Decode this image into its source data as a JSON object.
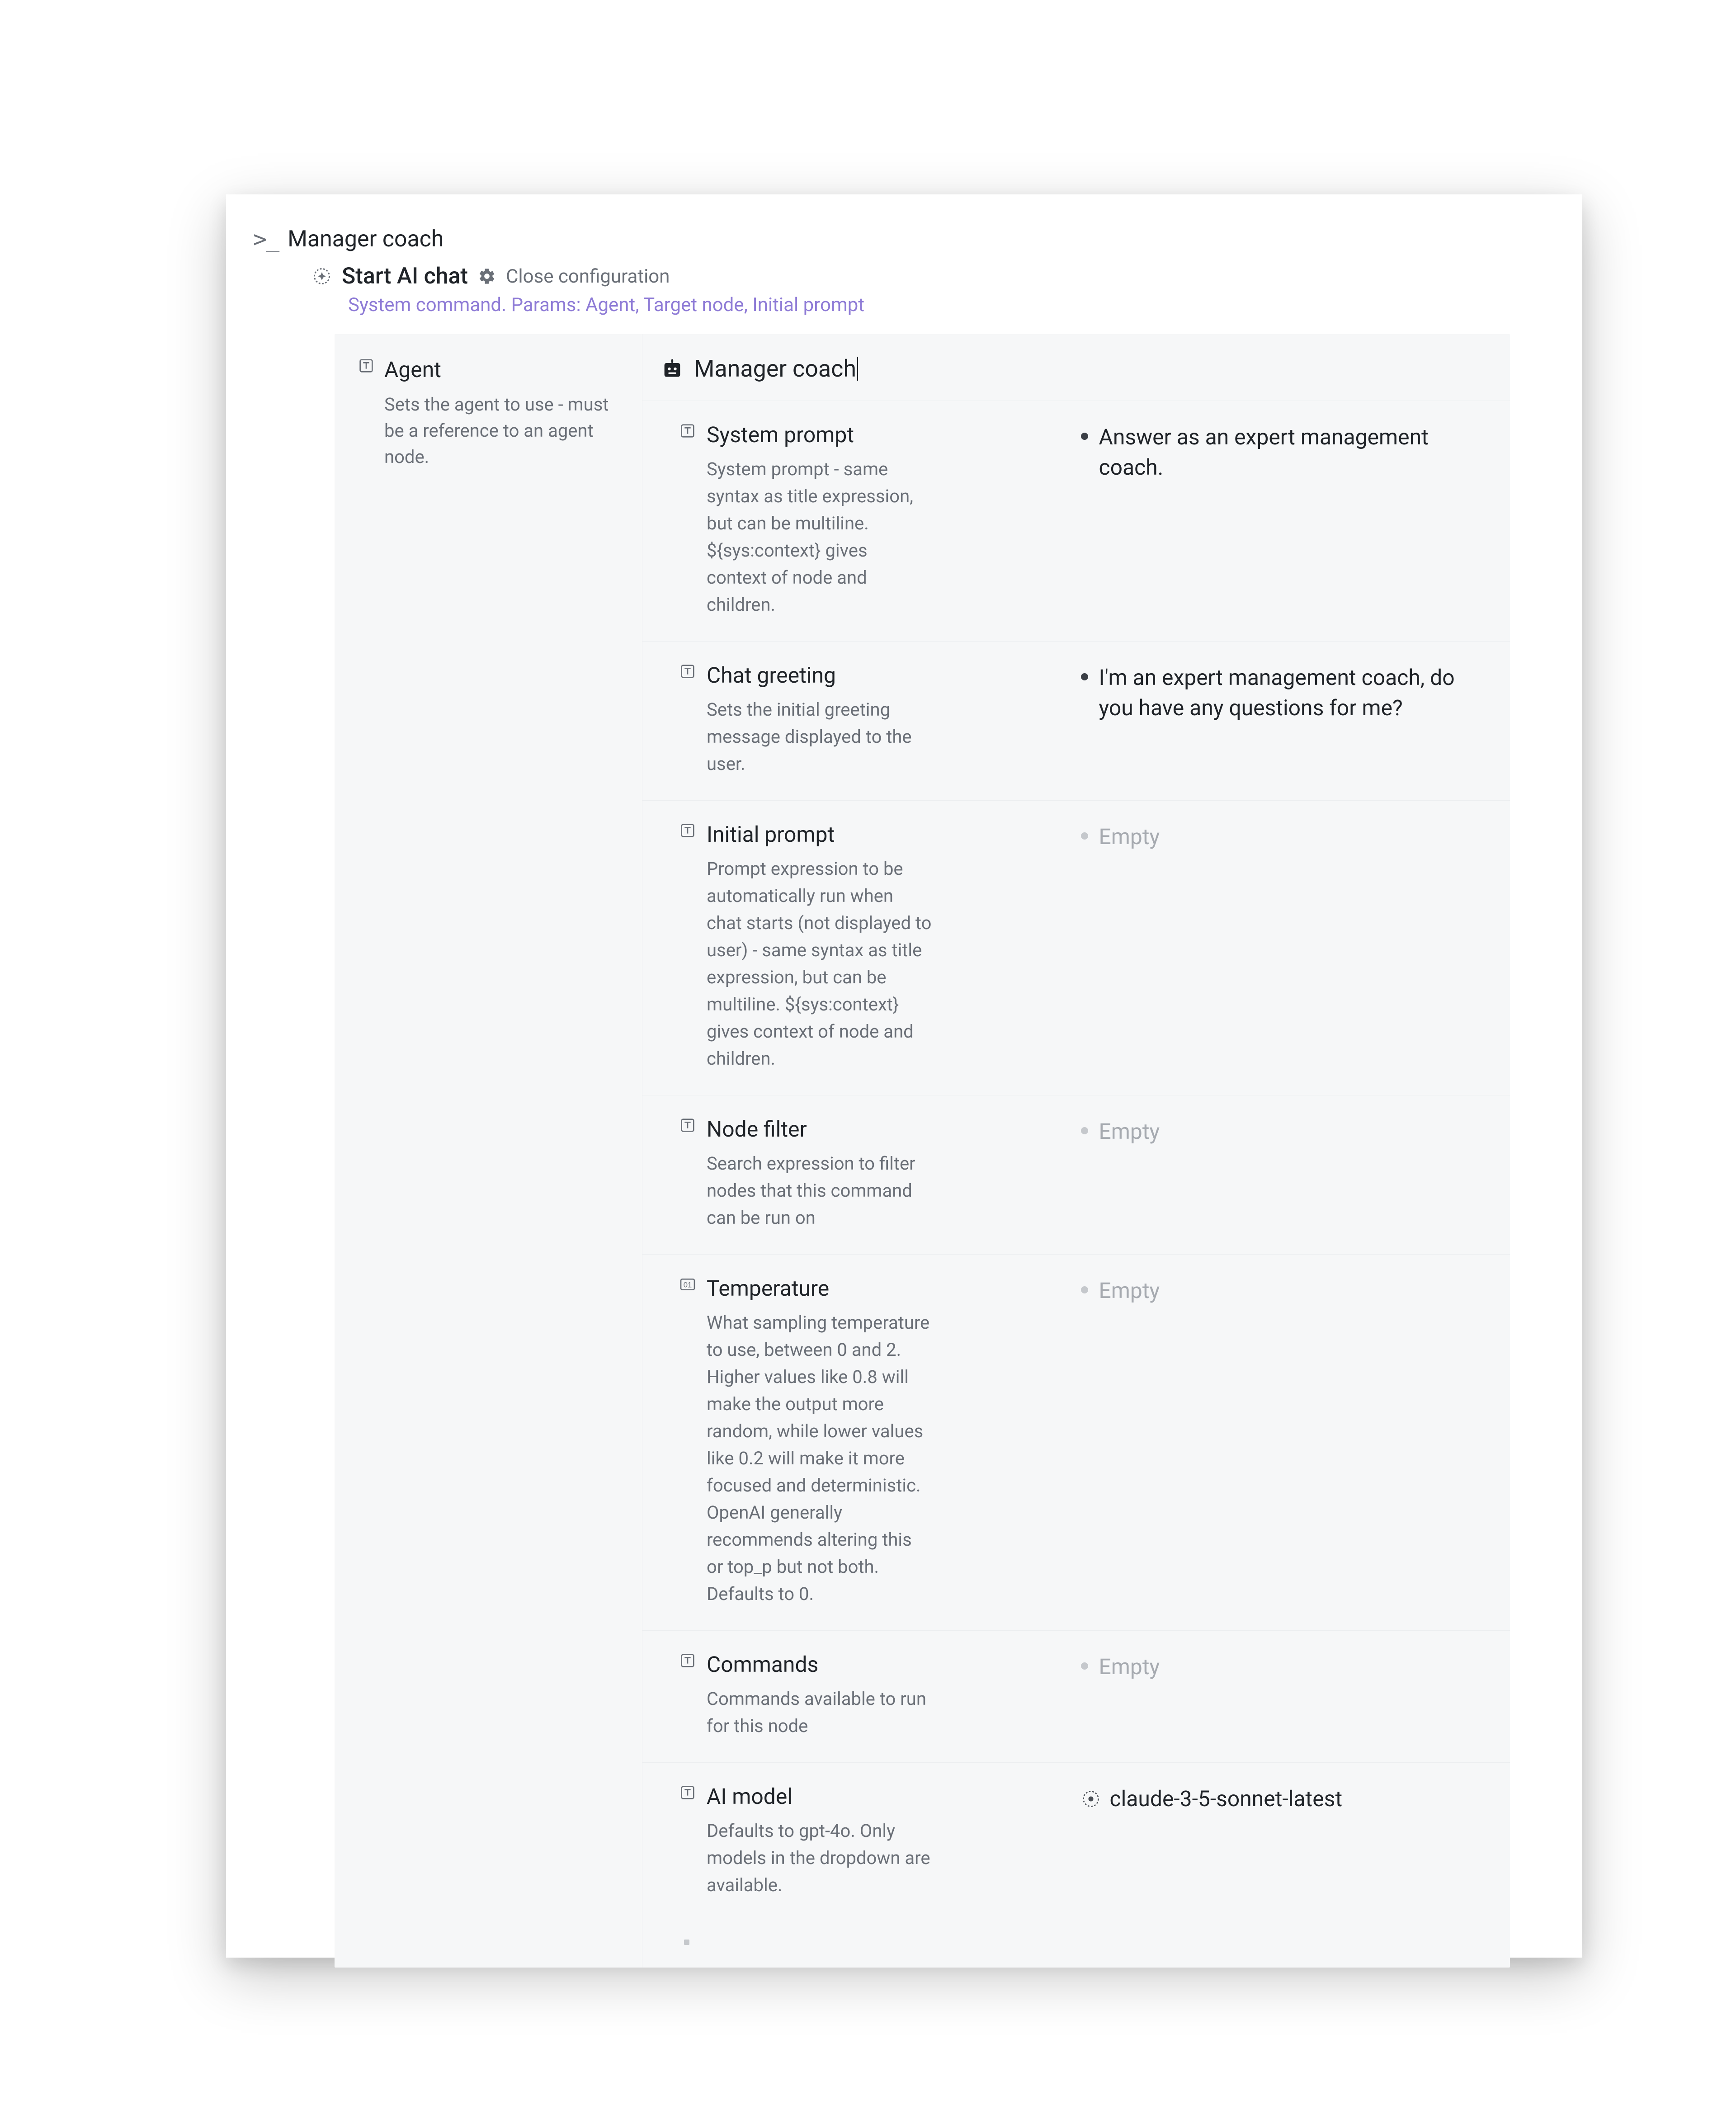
{
  "breadcrumb": {
    "title": "Manager coach"
  },
  "startRow": {
    "label": "Start AI chat",
    "closeLabel": "Close configuration"
  },
  "paramsLine": "System command. Params: Agent, Target node, Initial prompt",
  "agent": {
    "label": "Agent",
    "desc": "Sets the agent to use - must be a reference to an agent node.",
    "value": "Manager coach"
  },
  "props": [
    {
      "key": "system_prompt",
      "icon": "text",
      "title": "System prompt",
      "desc": "System prompt - same syntax as title expression, but can be multiline. ${sys:context} gives context of node and children.",
      "value": "Answer as an expert management coach.",
      "valueKind": "text"
    },
    {
      "key": "chat_greeting",
      "icon": "text",
      "title": "Chat greeting",
      "desc": "Sets the initial greeting message displayed to the user.",
      "value": "I'm an expert management coach, do you have any questions for me?",
      "valueKind": "text"
    },
    {
      "key": "initial_prompt",
      "icon": "text",
      "title": "Initial prompt",
      "desc": "Prompt expression to be automatically run when chat starts (not displayed to user) - same syntax as title expression, but can be multiline. ${sys:context} gives context of node and children.",
      "value": "Empty",
      "valueKind": "empty"
    },
    {
      "key": "node_filter",
      "icon": "text",
      "title": "Node filter",
      "desc": "Search expression to filter nodes that this command can be run on",
      "value": "Empty",
      "valueKind": "empty"
    },
    {
      "key": "temperature",
      "icon": "num",
      "title": "Temperature",
      "desc": "What sampling temperature to use, between 0 and 2. Higher values like 0.8 will make the output more random, while lower values like 0.2 will make it more focused and deterministic. OpenAI generally recommends altering this or top_p but not both. Defaults to 0.",
      "value": "Empty",
      "valueKind": "empty"
    },
    {
      "key": "commands",
      "icon": "text",
      "title": "Commands",
      "desc": "Commands available to run for this node",
      "value": "Empty",
      "valueKind": "empty"
    },
    {
      "key": "ai_model",
      "icon": "text",
      "title": "AI model",
      "desc": "Defaults to gpt-4o. Only models in the dropdown are available.",
      "value": "claude-3-5-sonnet-latest",
      "valueKind": "model"
    }
  ]
}
